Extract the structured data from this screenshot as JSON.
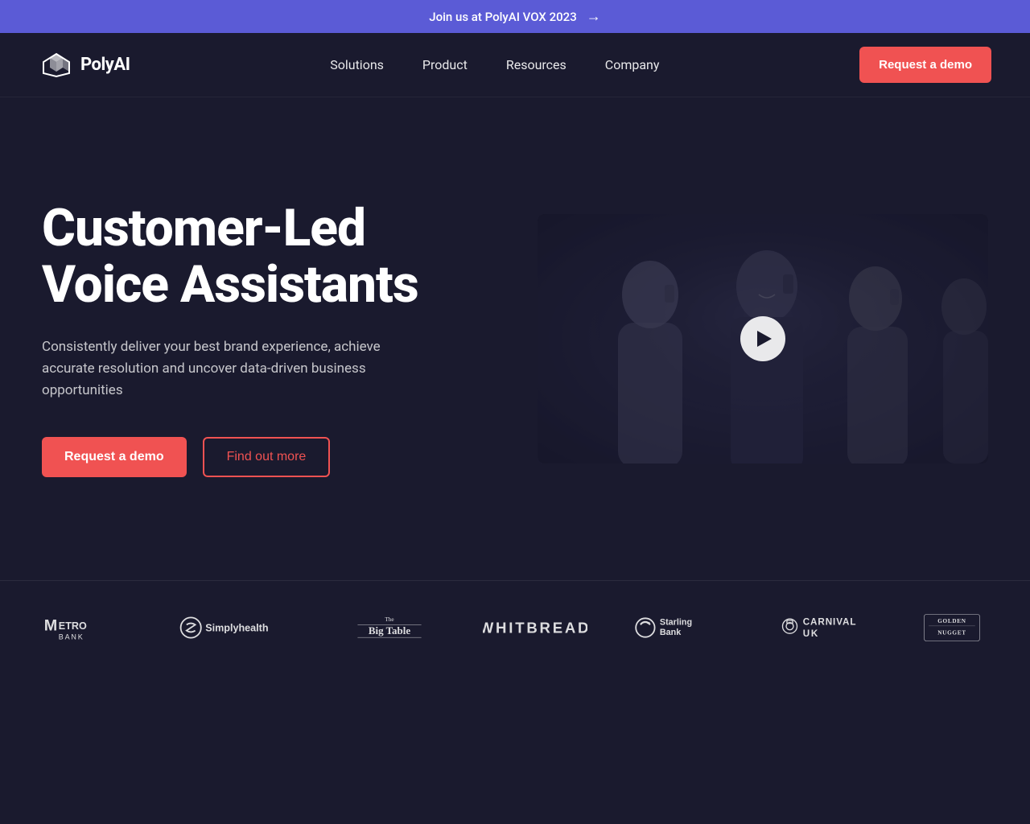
{
  "banner": {
    "text": "Join us at PolyAI VOX 2023",
    "arrow": "→"
  },
  "nav": {
    "logo_text": "PolyAI",
    "links": [
      {
        "label": "Solutions",
        "id": "solutions"
      },
      {
        "label": "Product",
        "id": "product"
      },
      {
        "label": "Resources",
        "id": "resources"
      },
      {
        "label": "Company",
        "id": "company"
      }
    ],
    "cta_label": "Request a demo"
  },
  "hero": {
    "title_line1": "Customer-Led",
    "title_line2": "Voice Assistants",
    "subtitle": "Consistently deliver your best brand experience, achieve accurate resolution and uncover data-driven business opportunities",
    "btn_primary": "Request a demo",
    "btn_outline": "Find out more"
  },
  "logos": [
    {
      "id": "metro-bank",
      "label": "METRO BANK"
    },
    {
      "id": "simplyhealth",
      "label": "Simplyhealth"
    },
    {
      "id": "big-table",
      "label": "The Big Table"
    },
    {
      "id": "whitbread",
      "label": "WHITBREAD"
    },
    {
      "id": "starling-bank",
      "label": "Starling Bank"
    },
    {
      "id": "carnival-uk",
      "label": "CARNIVAL UK"
    },
    {
      "id": "golden-nugget",
      "label": "GOLDEN NUGGET"
    }
  ],
  "colors": {
    "banner_bg": "#5b5bd6",
    "nav_bg": "#1a1a2e",
    "hero_bg": "#1a1a2e",
    "accent": "#f05252",
    "text_primary": "#ffffff",
    "text_muted": "rgba(255,255,255,0.75)"
  }
}
